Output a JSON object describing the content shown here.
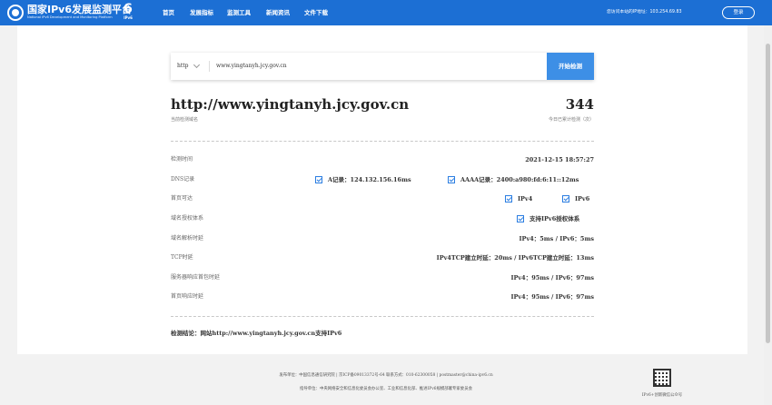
{
  "header": {
    "brand_cn": "国家IPv6发展监测平台",
    "brand_en": "National IPv6 Development and Monitoring Platform",
    "badge_num": "6",
    "badge_text": "IPv6",
    "nav": [
      "首页",
      "发展指标",
      "监测工具",
      "新闻资讯",
      "文件下载"
    ],
    "ip_info": "您访问本站的IP地址：103.254.69.83",
    "login_label": "登录"
  },
  "search": {
    "protocol": "http",
    "domain_value": "www.yingtanyh.jcy.gov.cn",
    "submit_label": "开始检测"
  },
  "result": {
    "site_url": "http://www.yingtanyh.jcy.gov.cn",
    "site_caption": "当前检测域名",
    "count": "344",
    "count_caption": "今日已累计检测（次）",
    "rows": {
      "time": {
        "label": "检测时间",
        "value": "2021-12-15 18:57:27"
      },
      "dns": {
        "label": "DNS记录",
        "a": "A记录：124.132.156.16ms",
        "aaaa": "AAAA记录：2400:a980:fd:6:11::12ms"
      },
      "homepage": {
        "label": "首页可达",
        "v4": "IPv4",
        "v6": "IPv6"
      },
      "authority": {
        "label": "域名授权体系",
        "value": "支持IPv6授权体系"
      },
      "resolve": {
        "label": "域名解析时延",
        "value": "IPv4：5ms / IPv6：5ms"
      },
      "tcp": {
        "label": "TCP时延",
        "value": "IPv4TCP建立时延：20ms / IPv6TCP建立时延：13ms"
      },
      "first_packet": {
        "label": "服务器响应首包时延",
        "value": "IPv4：95ms / IPv6：97ms"
      },
      "home_response": {
        "label": "首页响应时延",
        "value": "IPv4：95ms / IPv6：97ms"
      }
    },
    "conclusion": "检测结论：网站http://www.yingtanyh.jcy.gov.cn支持IPv6"
  },
  "footer": {
    "line1": "发布单位：中国信息通信研究院 | 京ICP备09013372号-64 联系方式：010-62300058 | postmaster@china-ipv6.cn",
    "line2": "指导单位：中央网络安全和信息化委员会办公室、工业和信息化部、推进IPv6规模部署专家委员会",
    "qr_label": "IPv6+创新微信公众号"
  }
}
